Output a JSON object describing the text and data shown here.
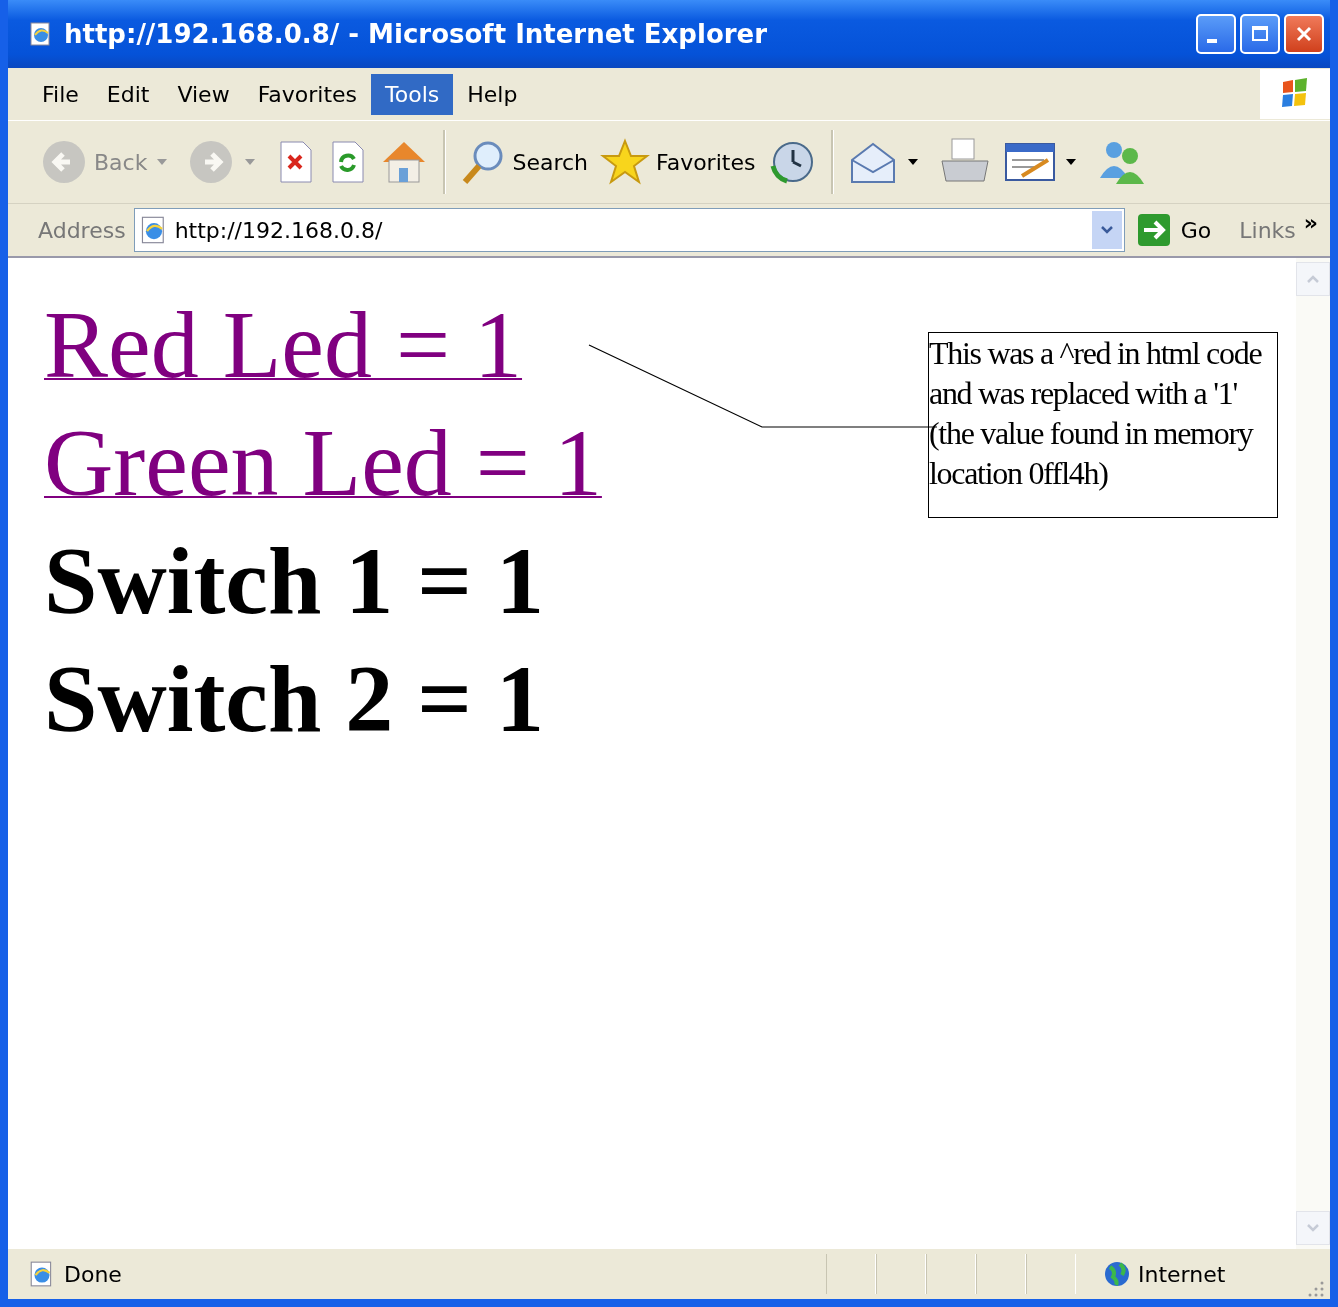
{
  "window": {
    "title": "http://192.168.0.8/ - Microsoft Internet Explorer"
  },
  "menu": [
    {
      "label": "File",
      "selected": false
    },
    {
      "label": "Edit",
      "selected": false
    },
    {
      "label": "View",
      "selected": false
    },
    {
      "label": "Favorites",
      "selected": false
    },
    {
      "label": "Tools",
      "selected": true
    },
    {
      "label": "Help",
      "selected": false
    }
  ],
  "toolbar": [
    {
      "kind": "back",
      "label": "Back",
      "disabled": true,
      "dropdown": true
    },
    {
      "kind": "forward",
      "disabled": true,
      "dropdown": true
    },
    {
      "kind": "stop",
      "disabled": false,
      "dropdown": false
    },
    {
      "kind": "refresh",
      "disabled": false,
      "dropdown": false
    },
    {
      "kind": "home",
      "disabled": false,
      "dropdown": false,
      "sep_after": true
    },
    {
      "kind": "search",
      "label": "Search",
      "disabled": false,
      "dropdown": false
    },
    {
      "kind": "favorites",
      "label": "Favorites",
      "disabled": false,
      "dropdown": false
    },
    {
      "kind": "history",
      "disabled": false,
      "dropdown": false,
      "sep_after": true
    },
    {
      "kind": "mail",
      "disabled": false,
      "dropdown": true
    },
    {
      "kind": "print",
      "disabled": false,
      "dropdown": false
    },
    {
      "kind": "edit",
      "disabled": false,
      "dropdown": true
    },
    {
      "kind": "messenger",
      "disabled": false,
      "dropdown": false
    }
  ],
  "address_bar": {
    "label": "Address",
    "value": "http://192.168.0.8/",
    "go": "Go",
    "links": "Links",
    "more": "»"
  },
  "page": {
    "lines": [
      {
        "kind": "link",
        "text": "Red Led = 1"
      },
      {
        "kind": "link",
        "text": "Green Led = 1"
      },
      {
        "kind": "heading",
        "text": "Switch 1 = 1"
      },
      {
        "kind": "heading",
        "text": "Switch 2 = 1"
      }
    ],
    "annotation": "This was a ^red in html code and was replaced with a '1' (the value found in memory location 0ffl4h)"
  },
  "status_bar": {
    "text": "Done",
    "zone": "Internet"
  }
}
